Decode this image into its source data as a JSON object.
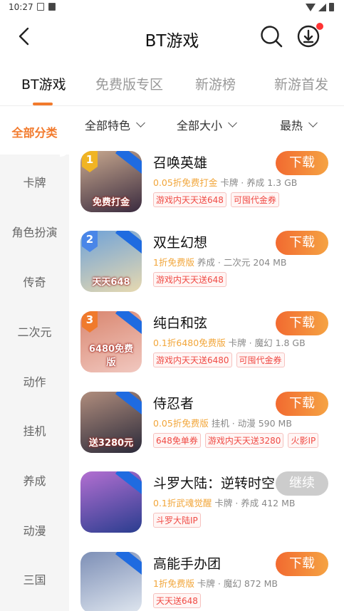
{
  "statusbar": {
    "time": "10:27"
  },
  "header": {
    "title": "BT游戏"
  },
  "tabs": [
    {
      "label": "BT游戏",
      "active": true
    },
    {
      "label": "免费版专区",
      "active": false
    },
    {
      "label": "新游榜",
      "active": false
    },
    {
      "label": "新游首发",
      "active": false
    }
  ],
  "sidebar": {
    "items": [
      "全部分类",
      "卡牌",
      "角色扮演",
      "传奇",
      "二次元",
      "动作",
      "挂机",
      "养成",
      "动漫",
      "三国"
    ],
    "active": "全部分类"
  },
  "filters": [
    {
      "label": "全部特色"
    },
    {
      "label": "全部大小"
    },
    {
      "label": "最热"
    }
  ],
  "games": [
    {
      "name": "召唤英雄",
      "highlight": "0.05折免费打金",
      "meta": " 卡牌 · 养成  1.3 GB",
      "tags": [
        "游戏内天天送648",
        "可囤代金券"
      ],
      "button": "下载",
      "rank": "1",
      "icon_caption": "免费打金",
      "icon_colors": [
        "#3a2b3f",
        "#c9a98f"
      ]
    },
    {
      "name": "双生幻想",
      "highlight": "1折免费版",
      "meta": " 养成 · 二次元  204 MB",
      "tags": [
        "游戏内天天送648"
      ],
      "button": "下载",
      "rank": "2",
      "icon_caption": "天天648",
      "icon_colors": [
        "#e7d9b0",
        "#6fa2d8"
      ]
    },
    {
      "name": "纯白和弦",
      "highlight": "0.1折6480免费版",
      "meta": " 卡牌 · 魔幻  1.8 GB",
      "tags": [
        "游戏内天天送6480",
        "可囤代金券"
      ],
      "button": "下载",
      "rank": "3",
      "icon_caption": "6480免费版",
      "icon_colors": [
        "#f1c8c0",
        "#d9866f"
      ]
    },
    {
      "name": "侍忍者",
      "highlight": "0.05折免费版",
      "meta": " 挂机 · 动漫  590 MB",
      "tags": [
        "648免单券",
        "游戏内天天送3280",
        "火影IP"
      ],
      "button": "下载",
      "rank": "",
      "icon_caption": "送3280元",
      "icon_colors": [
        "#2b2a3a",
        "#b08d7d"
      ]
    },
    {
      "name": "斗罗大陆：逆转时空",
      "highlight": "0.1折武魂觉醒",
      "meta": " 卡牌 · 养成  412 MB",
      "tags": [
        "斗罗大陆IP"
      ],
      "button": "继续",
      "rank": "",
      "icon_caption": "",
      "icon_colors": [
        "#2a3d8f",
        "#b36fd1"
      ]
    },
    {
      "name": "高能手办团",
      "highlight": "1折免费版",
      "meta": " 卡牌 · 魔幻  872 MB",
      "tags": [
        "天天送648"
      ],
      "button": "下载",
      "rank": "",
      "icon_caption": "",
      "icon_colors": [
        "#dfe6ef",
        "#7d8fb6"
      ]
    }
  ],
  "colors": {
    "accent": "#f27a2c",
    "tag_red": "#f04b45",
    "highlight_orange": "#f2a63a"
  }
}
